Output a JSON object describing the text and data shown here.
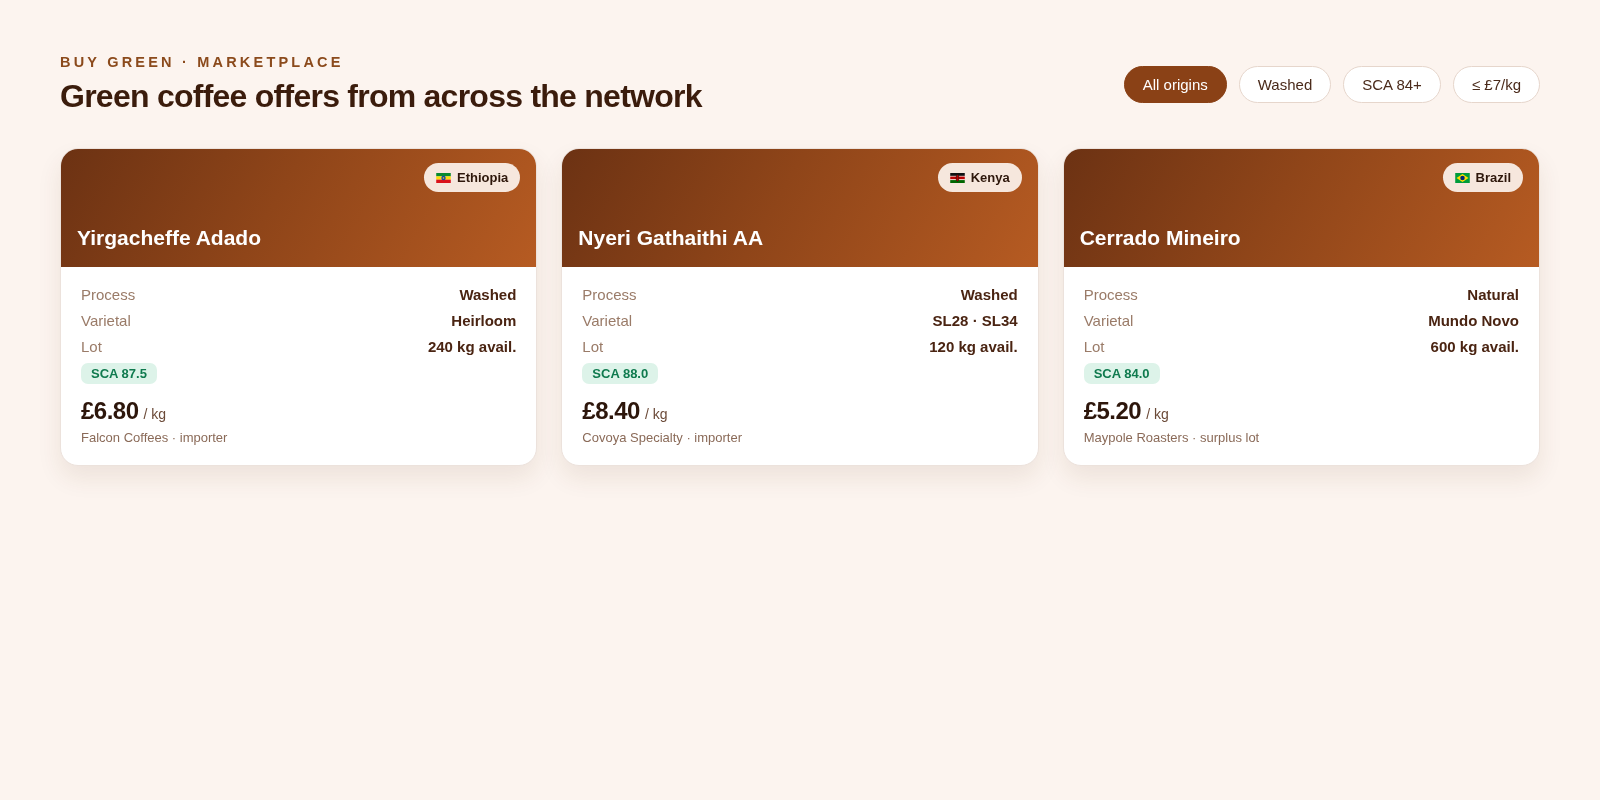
{
  "header": {
    "eyebrow": "BUY GREEN · MARKETPLACE",
    "title": "Green coffee offers from across the network"
  },
  "filters": [
    {
      "label": "All origins",
      "selected": true
    },
    {
      "label": "Washed",
      "selected": false
    },
    {
      "label": "SCA 84+",
      "selected": false
    },
    {
      "label": "≤ £7/kg",
      "selected": false
    }
  ],
  "offers": [
    {
      "name": "Yirgacheffe Adado",
      "origin": {
        "kind": "ethiopia",
        "label": "Ethiopia"
      },
      "specs": [
        {
          "label": "Process",
          "value": "Washed"
        },
        {
          "label": "Varietal",
          "value": "Heirloom"
        },
        {
          "label": "Lot",
          "value": "240 kg avail."
        }
      ],
      "score": "SCA 87.5",
      "price": "£6.80",
      "unit": "/ kg",
      "seller": "Falcon Coffees · importer"
    },
    {
      "name": "Nyeri Gathaithi AA",
      "origin": {
        "kind": "kenya",
        "label": "Kenya"
      },
      "specs": [
        {
          "label": "Process",
          "value": "Washed"
        },
        {
          "label": "Varietal",
          "value": "SL28 · SL34"
        },
        {
          "label": "Lot",
          "value": "120 kg avail."
        }
      ],
      "score": "SCA 88.0",
      "price": "£8.40",
      "unit": "/ kg",
      "seller": "Covoya Specialty · importer"
    },
    {
      "name": "Cerrado Mineiro",
      "origin": {
        "kind": "brazil",
        "label": "Brazil"
      },
      "specs": [
        {
          "label": "Process",
          "value": "Natural"
        },
        {
          "label": "Varietal",
          "value": "Mundo Novo"
        },
        {
          "label": "Lot",
          "value": "600 kg avail."
        }
      ],
      "score": "SCA 84.0",
      "price": "£5.20",
      "unit": "/ kg",
      "seller": "Maypole Roasters · surplus lot"
    }
  ]
}
